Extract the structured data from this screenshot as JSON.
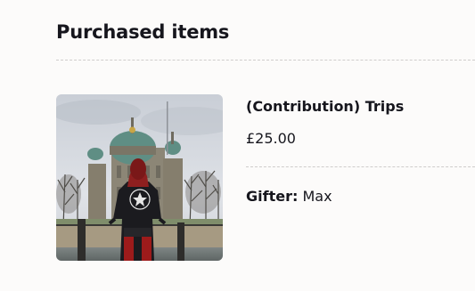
{
  "section": {
    "title": "Purchased items"
  },
  "item": {
    "name": "(Contribution) Trips",
    "price": "£25.00",
    "gifter_label": "Gifter:",
    "gifter_name": "Max"
  }
}
